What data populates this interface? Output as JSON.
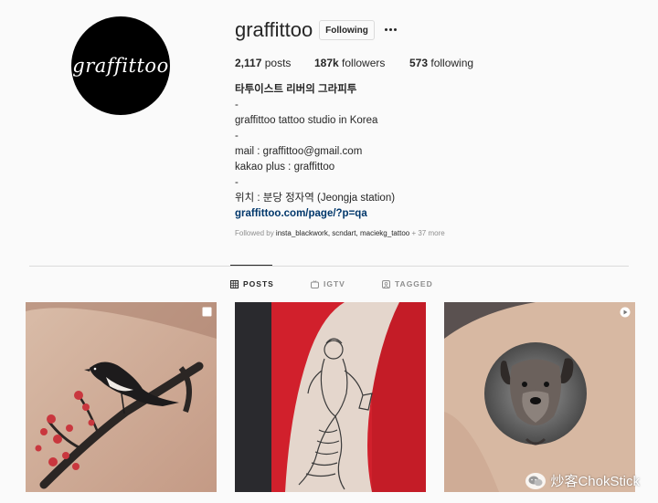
{
  "profile": {
    "avatar_text": "graffittoo",
    "username": "graffittoo",
    "follow_label": "Following",
    "stats": {
      "posts_count": "2,117",
      "posts_label": "posts",
      "followers_count": "187k",
      "followers_label": "followers",
      "following_count": "573",
      "following_label": "following"
    },
    "bio": {
      "name": "타투이스트 리버의 그라피투",
      "line1": "-",
      "line2": "graffittoo tattoo studio in Korea",
      "line3": "-",
      "line4": "mail : graffittoo@gmail.com",
      "line5": "kakao plus : graffittoo",
      "line6": "-",
      "line7": "위치 : 분당 정자역 (Jeongja station)",
      "link": "graffittoo.com/page/?p=qa"
    },
    "followed_by": {
      "prefix": "Followed by",
      "names": "insta_blackwork, scndart, maciekg_tattoo",
      "more": "+ 37 more"
    }
  },
  "tabs": [
    {
      "label": "POSTS",
      "icon": "grid-icon",
      "active": true
    },
    {
      "label": "IGTV",
      "icon": "igtv-icon",
      "active": false
    },
    {
      "label": "TAGGED",
      "icon": "tagged-icon",
      "active": false
    }
  ],
  "posts": [
    {
      "subject": "magpie on cherry blossom branch",
      "badge": "multiple-posts-icon"
    },
    {
      "subject": "mermaid line-work",
      "badge": ""
    },
    {
      "subject": "dog portrait",
      "badge": "video-icon"
    }
  ],
  "watermark": {
    "text": "炒客ChokStick",
    "icon": "wechat-icon"
  },
  "colors": {
    "link": "#00376b",
    "muted": "#8e8e8e",
    "text": "#262626",
    "border": "#dbdbdb"
  }
}
